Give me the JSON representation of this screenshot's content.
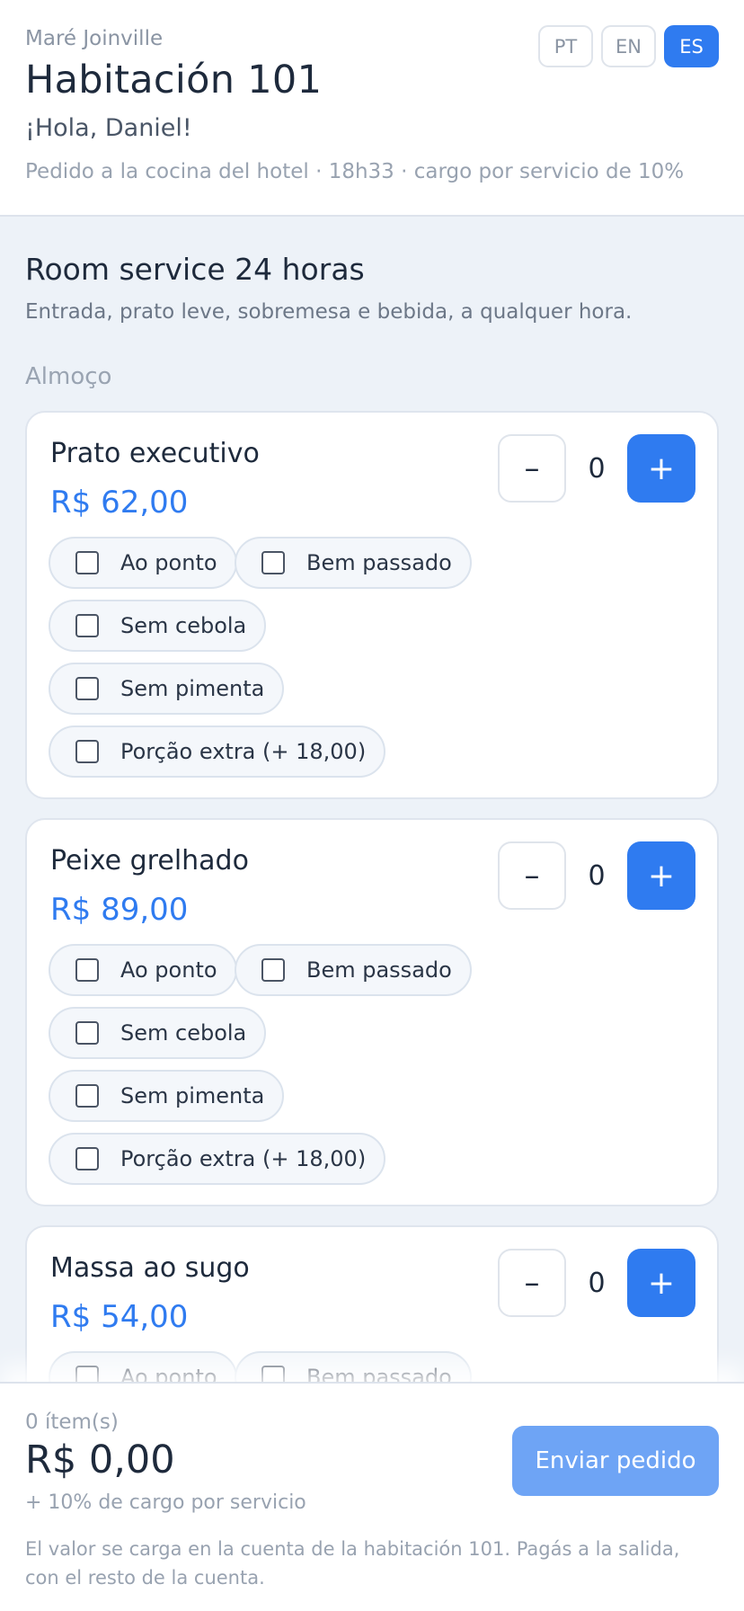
{
  "header": {
    "hotel_name": "Maré Joinville",
    "room_title": "Habitación 101",
    "greeting": "¡Hola, Daniel!",
    "subinfo": "Pedido a la cocina del hotel · 18h33 · cargo por servicio de 10%",
    "languages": [
      {
        "label": "PT",
        "active": false
      },
      {
        "label": "EN",
        "active": false
      },
      {
        "label": "ES",
        "active": true
      }
    ]
  },
  "section": {
    "title": "Room service 24 horas",
    "description": "Entrada, prato leve, sobremesa e bebida, a qualquer hora.",
    "category": "Almoço"
  },
  "items": [
    {
      "name": "Prato executivo",
      "price": "R$ 62,00",
      "quantity": "0",
      "minus": "–",
      "plus": "+",
      "options": [
        "Ao ponto",
        "Bem passado",
        "Sem cebola",
        "Sem pimenta",
        "Porção extra (+ 18,00)"
      ]
    },
    {
      "name": "Peixe grelhado",
      "price": "R$ 89,00",
      "quantity": "0",
      "minus": "–",
      "plus": "+",
      "options": [
        "Ao ponto",
        "Bem passado",
        "Sem cebola",
        "Sem pimenta",
        "Porção extra (+ 18,00)"
      ]
    },
    {
      "name": "Massa ao sugo",
      "price": "R$ 54,00",
      "quantity": "0",
      "minus": "–",
      "plus": "+",
      "options": [
        "Ao ponto",
        "Bem passado"
      ]
    }
  ],
  "footer": {
    "items_count": "0 ítem(s)",
    "total": "R$ 0,00",
    "service_fee": "+ 10% de cargo por servicio",
    "send_label": "Enviar pedido",
    "disclaimer": "El valor se carga en la cuenta de la habitación 101. Pagás a la salida, con el resto de la cuenta."
  },
  "colors": {
    "accent": "#2f7bf0",
    "accent_disabled": "#6ea4f5",
    "background": "#edf2f8"
  }
}
